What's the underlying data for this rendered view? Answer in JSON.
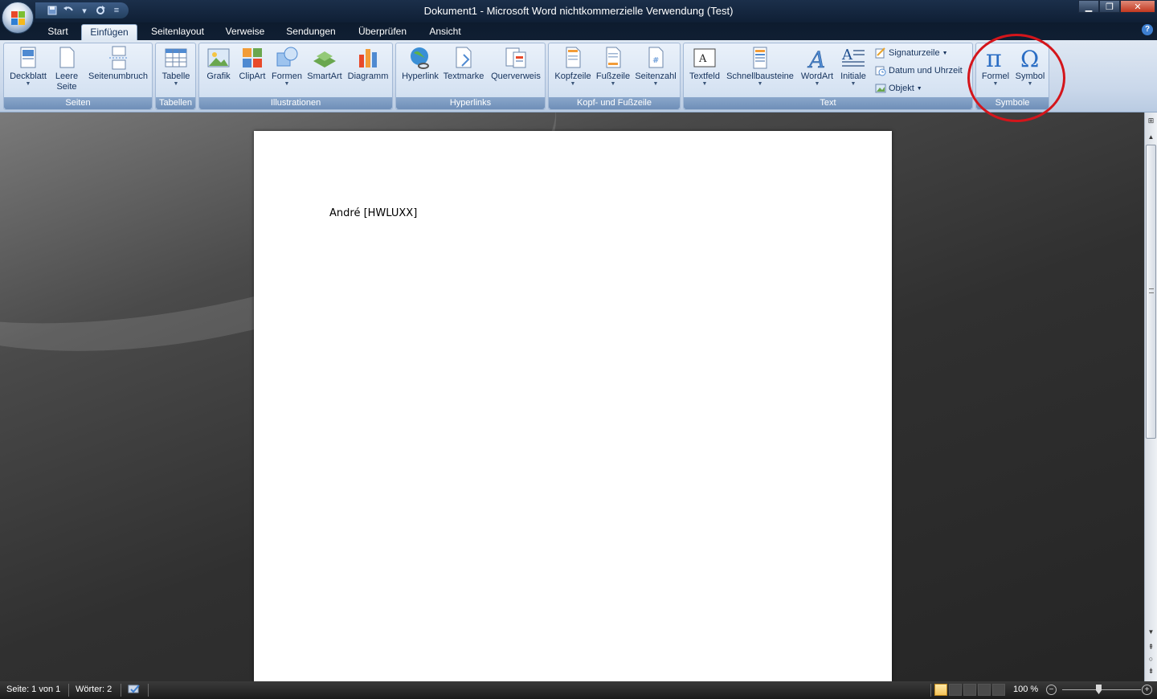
{
  "window": {
    "title": "Dokument1 - Microsoft Word nichtkommerzielle Verwendung (Test)"
  },
  "quick_access": {
    "icons": [
      "save-icon",
      "undo-icon",
      "redo-icon",
      "customize-icon"
    ]
  },
  "tabs": [
    {
      "label": "Start",
      "active": false
    },
    {
      "label": "Einfügen",
      "active": true
    },
    {
      "label": "Seitenlayout",
      "active": false
    },
    {
      "label": "Verweise",
      "active": false
    },
    {
      "label": "Sendungen",
      "active": false
    },
    {
      "label": "Überprüfen",
      "active": false
    },
    {
      "label": "Ansicht",
      "active": false
    }
  ],
  "ribbon": {
    "groups": {
      "seiten": {
        "label": "Seiten",
        "buttons": {
          "deckblatt": "Deckblatt",
          "leere_seite_1": "Leere",
          "leere_seite_2": "Seite",
          "seitenumbruch": "Seitenumbruch"
        }
      },
      "tabellen": {
        "label": "Tabellen",
        "buttons": {
          "tabelle": "Tabelle"
        }
      },
      "illustrationen": {
        "label": "Illustrationen",
        "buttons": {
          "grafik": "Grafik",
          "clipart": "ClipArt",
          "formen": "Formen",
          "smartart": "SmartArt",
          "diagramm": "Diagramm"
        }
      },
      "hyperlinks": {
        "label": "Hyperlinks",
        "buttons": {
          "hyperlink": "Hyperlink",
          "textmarke": "Textmarke",
          "querverweis": "Querverweis"
        }
      },
      "kopf_fusszeile": {
        "label": "Kopf- und Fußzeile",
        "buttons": {
          "kopfzeile": "Kopfzeile",
          "fusszeile": "Fußzeile",
          "seitenzahl": "Seitenzahl"
        }
      },
      "text": {
        "label": "Text",
        "buttons": {
          "textfeld": "Textfeld",
          "schnellbausteine": "Schnellbausteine",
          "wordart": "WordArt",
          "initiale": "Initiale",
          "signaturzeile": "Signaturzeile",
          "datum_uhrzeit": "Datum und Uhrzeit",
          "objekt": "Objekt"
        }
      },
      "symbole": {
        "label": "Symbole",
        "buttons": {
          "formel": "Formel",
          "symbol": "Symbol"
        }
      }
    }
  },
  "document": {
    "body_text": "André [HWLUXX]"
  },
  "statusbar": {
    "page": "Seite: 1 von 1",
    "words": "Wörter: 2",
    "zoom": "100 %"
  },
  "colors": {
    "highlight_circle": "#d4151b",
    "titlebar": "#0f1f35",
    "ribbon": "#dfe8f3"
  }
}
